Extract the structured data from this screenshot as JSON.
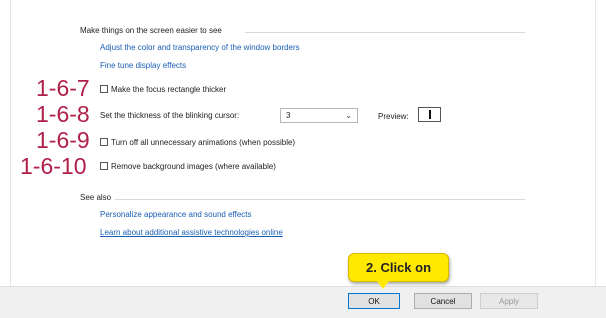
{
  "sections": {
    "screen_easier": {
      "title": "Make things on the screen easier to see",
      "links": [
        "Adjust the color and transparency of the window borders",
        "Fine tune display effects"
      ]
    },
    "options": [
      {
        "annotation": "1-6-7",
        "label": "Make the focus rectangle thicker",
        "checked": false
      },
      {
        "annotation": "1-6-8",
        "label": "Set the thickness of the blinking cursor:"
      },
      {
        "annotation": "1-6-9",
        "label": "Turn off all unnecessary animations (when possible)",
        "checked": false
      },
      {
        "annotation": "1-6-10",
        "label": "Remove background images (where available)",
        "checked": false
      }
    ],
    "cursor_thickness": {
      "value": "3",
      "preview_label": "Preview:"
    },
    "see_also": {
      "title": "See also",
      "links": [
        "Personalize appearance and sound effects",
        "Learn about additional assistive technologies online"
      ]
    }
  },
  "footer": {
    "callout": "2. Click on",
    "ok": "OK",
    "cancel": "Cancel",
    "apply": "Apply"
  },
  "colors": {
    "annotation": "#b0204a",
    "link": "#1a5fb4",
    "callout": "#ffe900"
  }
}
